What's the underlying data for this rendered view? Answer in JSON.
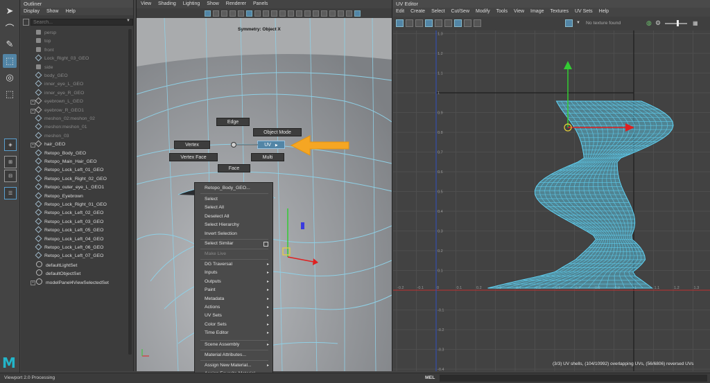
{
  "outliner": {
    "title": "Outliner",
    "menu": [
      "Display",
      "Show",
      "Help"
    ],
    "search_placeholder": "Search...",
    "items": [
      {
        "label": "persp",
        "style": "dim",
        "icon": "camera-icon",
        "expander": ""
      },
      {
        "label": "top",
        "style": "dim",
        "icon": "camera-icon",
        "expander": ""
      },
      {
        "label": "front",
        "style": "dim",
        "icon": "camera-icon",
        "expander": ""
      },
      {
        "label": "Lock_Right_03_GEO",
        "style": "dim",
        "icon": "mesh-icon",
        "expander": ""
      },
      {
        "label": "side",
        "style": "dim",
        "icon": "camera-icon",
        "expander": ""
      },
      {
        "label": "body_GEO",
        "style": "dim",
        "icon": "mesh-icon",
        "expander": ""
      },
      {
        "label": "inner_eye_L_GEO",
        "style": "dim",
        "icon": "mesh-icon",
        "expander": ""
      },
      {
        "label": "inner_eye_R_GEO",
        "style": "dim",
        "icon": "mesh-icon",
        "expander": ""
      },
      {
        "label": "eyebrown_L_GEO",
        "style": "dim",
        "icon": "group-icon",
        "expander": "+"
      },
      {
        "label": "eyebrow_R_GEO1",
        "style": "dim",
        "icon": "group-icon",
        "expander": "+"
      },
      {
        "label": "meshon_02:meshon_02",
        "style": "dim",
        "icon": "mesh-icon",
        "expander": ""
      },
      {
        "label": "meshon:meshon_01",
        "style": "dim",
        "icon": "mesh-icon",
        "expander": ""
      },
      {
        "label": "meshon_03",
        "style": "dim",
        "icon": "mesh-icon",
        "expander": ""
      },
      {
        "label": "hair_GEO",
        "style": "bright",
        "icon": "group-icon",
        "expander": "+"
      },
      {
        "label": "Retopo_Body_GEO",
        "style": "bright",
        "icon": "mesh-icon",
        "expander": ""
      },
      {
        "label": "Retopo_Main_Hair_GEO",
        "style": "bright",
        "icon": "mesh-icon",
        "expander": ""
      },
      {
        "label": "Retopo_Lock_Left_01_GEO",
        "style": "bright",
        "icon": "mesh-icon",
        "expander": ""
      },
      {
        "label": "Retopo_Lock_Right_02_GEO",
        "style": "bright",
        "icon": "mesh-icon",
        "expander": ""
      },
      {
        "label": "Retopo_outer_eye_L_GEO1",
        "style": "bright",
        "icon": "mesh-icon",
        "expander": ""
      },
      {
        "label": "Retopo_Eyebrown",
        "style": "bright",
        "icon": "mesh-icon",
        "expander": ""
      },
      {
        "label": "Retopo_Lock_Right_01_GEO",
        "style": "bright",
        "icon": "mesh-icon",
        "expander": ""
      },
      {
        "label": "Retopo_Lock_Left_02_GEO",
        "style": "bright",
        "icon": "mesh-icon",
        "expander": ""
      },
      {
        "label": "Retopo_Lock_Left_03_GEO",
        "style": "bright",
        "icon": "mesh-icon",
        "expander": ""
      },
      {
        "label": "Retopo_Lock_Left_05_GEO",
        "style": "bright",
        "icon": "mesh-icon",
        "expander": ""
      },
      {
        "label": "Retopo_Lock_Left_04_GEO",
        "style": "bright",
        "icon": "mesh-icon",
        "expander": ""
      },
      {
        "label": "Retopo_Lock_Left_06_GEO",
        "style": "bright",
        "icon": "mesh-icon",
        "expander": ""
      },
      {
        "label": "Retopo_Lock_Left_07_GEO",
        "style": "bright",
        "icon": "mesh-icon",
        "expander": ""
      },
      {
        "label": "defaultLightSet",
        "style": "bright",
        "icon": "set-icon",
        "expander": ""
      },
      {
        "label": "defaultObjectSet",
        "style": "bright",
        "icon": "set-icon",
        "expander": ""
      },
      {
        "label": "modelPanel4ViewSelectedSet",
        "style": "bright",
        "icon": "set-icon",
        "expander": "+"
      }
    ]
  },
  "viewport": {
    "menu": [
      "View",
      "Shading",
      "Lighting",
      "Show",
      "Renderer",
      "Panels"
    ],
    "symmetry": "Symmetry: Object X",
    "marking_menu": {
      "edge": "Edge",
      "object_mode": "Object Mode",
      "vertex": "Vertex",
      "uv": "UV",
      "vertex_face": "Vertex Face",
      "multi": "Multi",
      "face": "Face"
    },
    "context_menu": {
      "title": "Retopo_Body_GEO...",
      "items": [
        {
          "label": "Select",
          "arrow": ""
        },
        {
          "label": "Select All",
          "arrow": ""
        },
        {
          "label": "Deselect All",
          "arrow": ""
        },
        {
          "label": "Select Hierarchy",
          "arrow": ""
        },
        {
          "label": "Invert Selection",
          "arrow": ""
        }
      ],
      "select_similar": "Select Similar",
      "make_live": "Make Live",
      "submenus": [
        {
          "label": "DG Traversal",
          "arrow": "▸"
        },
        {
          "label": "Inputs",
          "arrow": "▸"
        },
        {
          "label": "Outputs",
          "arrow": "▸"
        },
        {
          "label": "Paint",
          "arrow": "▸"
        },
        {
          "label": "Metadata",
          "arrow": "▸"
        },
        {
          "label": "Actions",
          "arrow": "▸"
        },
        {
          "label": "UV Sets",
          "arrow": "▸"
        },
        {
          "label": "Color Sets",
          "arrow": "▸"
        },
        {
          "label": "Time Editor",
          "arrow": "▸"
        }
      ],
      "scene_assembly": "Scene Assembly",
      "material_attributes": "Material Attributes...",
      "assign_new_material": "Assign New Material...",
      "assign_favorite_material": "Assign Favorite Material",
      "arrow": "▸"
    },
    "annotation_arrow_color": "#f5a623"
  },
  "uv_editor": {
    "title": "UV Editor",
    "menu": [
      "Edit",
      "Create",
      "Select",
      "Cut/Sew",
      "Modify",
      "Tools",
      "View",
      "Image",
      "Textures",
      "UV Sets",
      "Help"
    ],
    "texture_label": "No texture found",
    "status": "(3/3) UV shells, (104/10992) overlapping UVs, (56/6806) reversed UVs",
    "x_ticks": [
      "-0.2",
      "-0.1",
      "0",
      "0.1",
      "0.2",
      "0.3",
      "0.4",
      "0.5",
      "0.6",
      "0.7",
      "0.8",
      "0.9",
      "1",
      "1.1",
      "1.2",
      "1.3"
    ],
    "y_ticks_pos": [
      "1.3",
      "1.2",
      "1.1",
      "1",
      "0.9",
      "0.8",
      "0.7",
      "0.6",
      "0.5",
      "0.4",
      "0.3",
      "0.2",
      "0.1"
    ],
    "y_ticks_neg": [
      "-0.1",
      "-0.2",
      "-0.3",
      "-0.4",
      "-0.5"
    ],
    "wire_color": "#5fd3f5"
  },
  "statusbar": {
    "text": "Viewport 2.0 Processing",
    "mel": "MEL"
  }
}
